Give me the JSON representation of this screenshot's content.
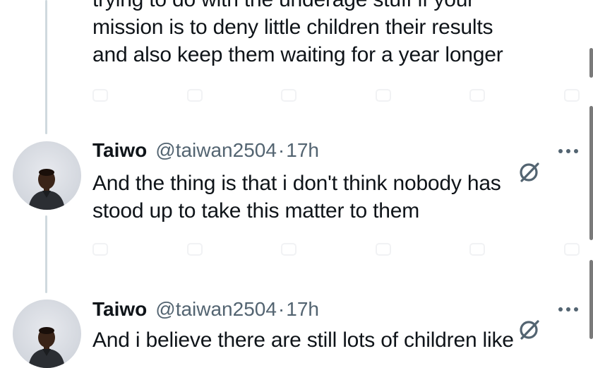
{
  "tweets": [
    {
      "text_lines": [
        "trying to do with the underage stuff if your",
        "mission is to deny little children their results",
        "and also keep them waiting for a year longer"
      ]
    },
    {
      "author": {
        "name": "Taiwo",
        "handle": "@taiwan2504",
        "separator": "·",
        "time": "17h"
      },
      "text_lines": [
        "And the thing is that i don't think nobody has",
        "stood up to take this matter to them"
      ]
    },
    {
      "author": {
        "name": "Taiwo",
        "handle": "@taiwan2504",
        "separator": "·",
        "time": "17h"
      },
      "text_lines": [
        "And i believe there are still lots of children like"
      ]
    }
  ],
  "icons": {
    "grok": "grok-icon",
    "more": "more-options-icon",
    "actions": [
      "reply-icon",
      "retweet-icon",
      "like-icon",
      "views-icon",
      "bookmark-icon",
      "share-icon"
    ]
  },
  "colors": {
    "text": "#0f1419",
    "secondary": "#536471",
    "thread_line": "#cfd9de"
  }
}
